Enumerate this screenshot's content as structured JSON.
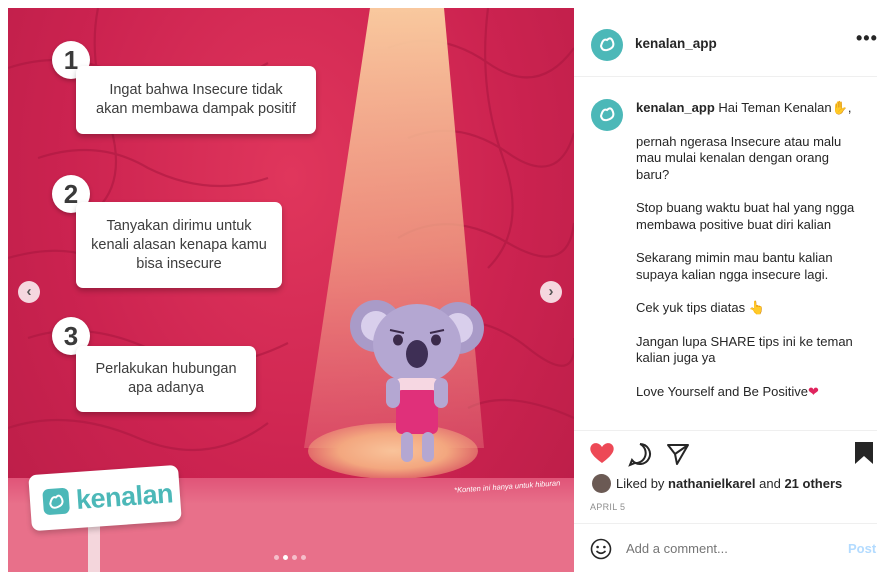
{
  "slide": {
    "tips": [
      {
        "number": "1",
        "text": "Ingat bahwa Insecure tidak\nakan membawa dampak positif"
      },
      {
        "number": "2",
        "text": "Tanyakan dirimu untuk\nkenali alasan kenapa kamu\nbisa insecure"
      },
      {
        "number": "3",
        "text": "Perlakukan hubungan\napa adanya"
      }
    ],
    "brand": "kenalan",
    "disclaimer": "*Konten ini hanya untuk hiburan",
    "prev_arrow": "‹",
    "next_arrow": "›",
    "carousel": {
      "count": 4,
      "active_index": 1
    },
    "colors": {
      "background": "#cc2350",
      "brand_teal": "#4cb8b8",
      "koala": "#a99bc8",
      "dress": "#e0307a"
    }
  },
  "header": {
    "username": "kenalan_app",
    "more_icon": "more-horizontal-icon",
    "more_label": "•••"
  },
  "caption": {
    "username": "kenalan_app",
    "first_line": "Hai Teman Kenalan",
    "first_line_emoji": "✋",
    "first_line_suffix": ",",
    "paragraphs": [
      "pernah ngerasa Insecure atau malu mau mulai kenalan dengan orang baru?",
      "Stop buang waktu buat hal yang ngga membawa positive buat diri kalian",
      "Sekarang mimin mau bantu kalian supaya kalian ngga insecure lagi.",
      "Cek yuk tips diatas",
      "Jangan lupa SHARE tips ini ke teman kalian juga ya",
      "Love Yourself and Be Positive"
    ],
    "tips_emoji": "👆",
    "love_emoji": "❤"
  },
  "actions": {
    "like_icon": "heart-icon",
    "comment_icon": "comment-bubble-icon",
    "share_icon": "paper-plane-icon",
    "save_icon": "bookmark-icon",
    "liked_prefix": "Liked by",
    "liked_user": "nathanielkarel",
    "liked_and": "and",
    "liked_others": "21 others",
    "date": "APRIL 5",
    "comment_placeholder": "Add a comment...",
    "post_label": "Post",
    "heart_color": "#ed4956"
  }
}
